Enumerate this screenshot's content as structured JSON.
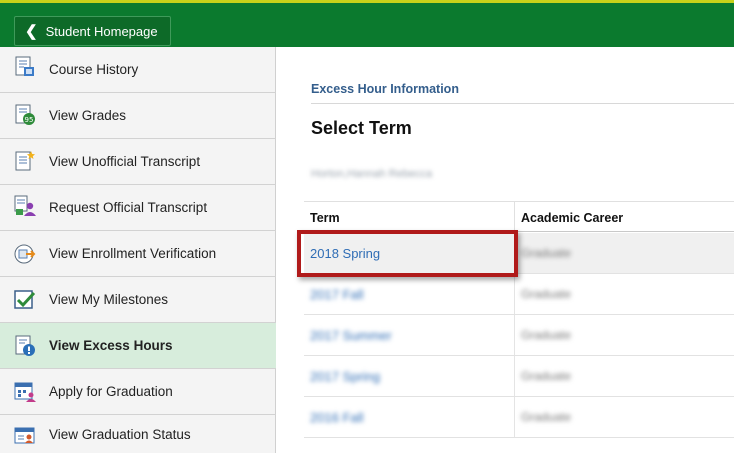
{
  "header": {
    "home_label": "Student Homepage"
  },
  "sidebar": {
    "items": [
      {
        "label": "Course History",
        "icon": "course-history-icon"
      },
      {
        "label": "View Grades",
        "icon": "grades-icon"
      },
      {
        "label": "View Unofficial Transcript",
        "icon": "transcript-icon"
      },
      {
        "label": "Request Official Transcript",
        "icon": "request-transcript-icon"
      },
      {
        "label": "View Enrollment Verification",
        "icon": "enrollment-verification-icon"
      },
      {
        "label": "View My Milestones",
        "icon": "milestones-icon"
      },
      {
        "label": "View Excess Hours",
        "icon": "excess-hours-icon",
        "active": true
      },
      {
        "label": "Apply for Graduation",
        "icon": "graduation-calendar-icon"
      },
      {
        "label": "View Graduation Status",
        "icon": "graduation-status-icon"
      }
    ]
  },
  "main": {
    "section_title": "Excess Hour Information",
    "page_title": "Select Term",
    "student_name": "Horton,Hannah Rebecca",
    "table": {
      "headers": [
        "Term",
        "Academic Career"
      ],
      "rows": [
        {
          "term": "2018 Spring",
          "career": "Graduate"
        },
        {
          "term": "2017 Fall",
          "career": "Graduate"
        },
        {
          "term": "2017 Summer",
          "career": "Graduate"
        },
        {
          "term": "2017 Spring",
          "career": "Graduate"
        },
        {
          "term": "2016 Fall",
          "career": "Graduate"
        }
      ]
    }
  },
  "colors": {
    "header_green": "#0b7a2e",
    "active_item": "#d7eddc",
    "link_blue": "#2f6db5",
    "callout_red": "#b01a1a"
  }
}
